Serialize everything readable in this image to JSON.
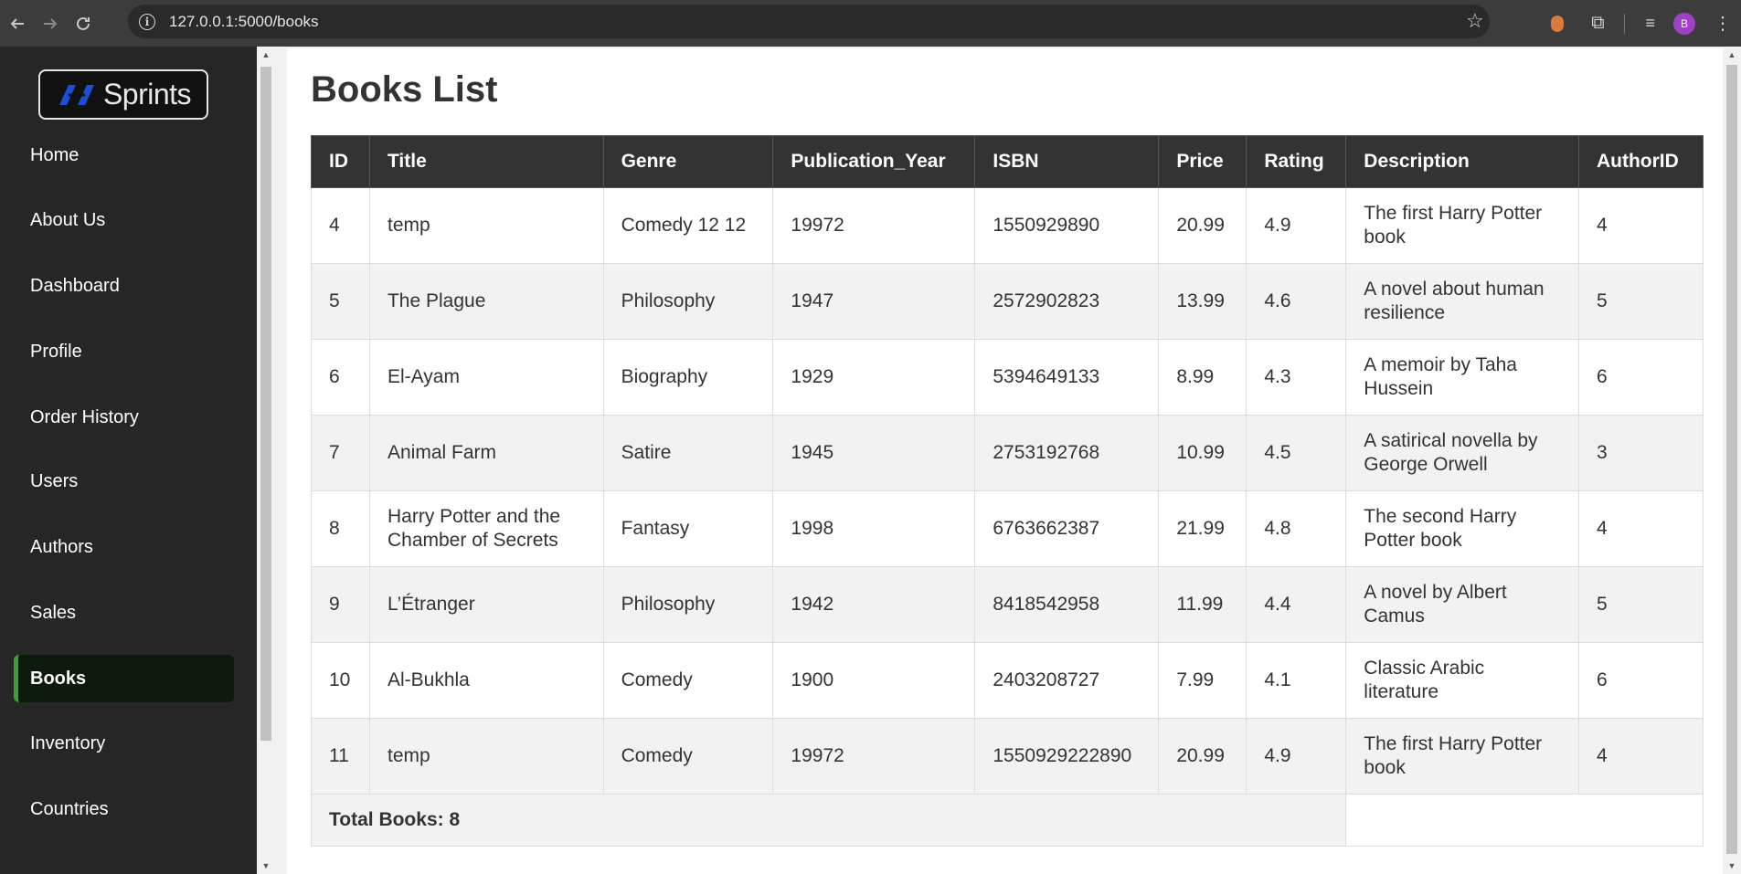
{
  "browser": {
    "url": "127.0.0.1:5000/books",
    "profile_initial": "B"
  },
  "sidebar": {
    "logo_text": "Sprints",
    "items": [
      {
        "label": "Home",
        "active": false
      },
      {
        "label": "About Us",
        "active": false
      },
      {
        "label": "Dashboard",
        "active": false
      },
      {
        "label": "Profile",
        "active": false
      },
      {
        "label": "Order History",
        "active": false
      },
      {
        "label": "Users",
        "active": false
      },
      {
        "label": "Authors",
        "active": false
      },
      {
        "label": "Sales",
        "active": false
      },
      {
        "label": "Books",
        "active": true
      },
      {
        "label": "Inventory",
        "active": false
      },
      {
        "label": "Countries",
        "active": false
      }
    ]
  },
  "page": {
    "title": "Books List",
    "columns": [
      "ID",
      "Title",
      "Genre",
      "Publication_Year",
      "ISBN",
      "Price",
      "Rating",
      "Description",
      "AuthorID"
    ],
    "rows": [
      [
        "4",
        "temp",
        "Comedy 12 12",
        "19972",
        "1550929890",
        "20.99",
        "4.9",
        "The first Harry Potter book",
        "4"
      ],
      [
        "5",
        "The Plague",
        "Philosophy",
        "1947",
        "2572902823",
        "13.99",
        "4.6",
        "A novel about human resilience",
        "5"
      ],
      [
        "6",
        "El-Ayam",
        "Biography",
        "1929",
        "5394649133",
        "8.99",
        "4.3",
        "A memoir by Taha Hussein",
        "6"
      ],
      [
        "7",
        "Animal Farm",
        "Satire",
        "1945",
        "2753192768",
        "10.99",
        "4.5",
        "A satirical novella by George Orwell",
        "3"
      ],
      [
        "8",
        "Harry Potter and the Chamber of Secrets",
        "Fantasy",
        "1998",
        "6763662387",
        "21.99",
        "4.8",
        "The second Harry Potter book",
        "4"
      ],
      [
        "9",
        "L’Étranger",
        "Philosophy",
        "1942",
        "8418542958",
        "11.99",
        "4.4",
        "A novel by Albert Camus",
        "5"
      ],
      [
        "10",
        "Al-Bukhla",
        "Comedy",
        "1900",
        "2403208727",
        "7.99",
        "4.1",
        "Classic Arabic literature",
        "6"
      ],
      [
        "11",
        "temp",
        "Comedy",
        "19972",
        "1550929222890",
        "20.99",
        "4.9",
        "The first Harry Potter book",
        "4"
      ]
    ],
    "total_label": "Total Books: 8"
  },
  "colors": {
    "sidebar_bg": "#262626",
    "active_accent": "#3aa03a",
    "header_bg": "#333333"
  }
}
